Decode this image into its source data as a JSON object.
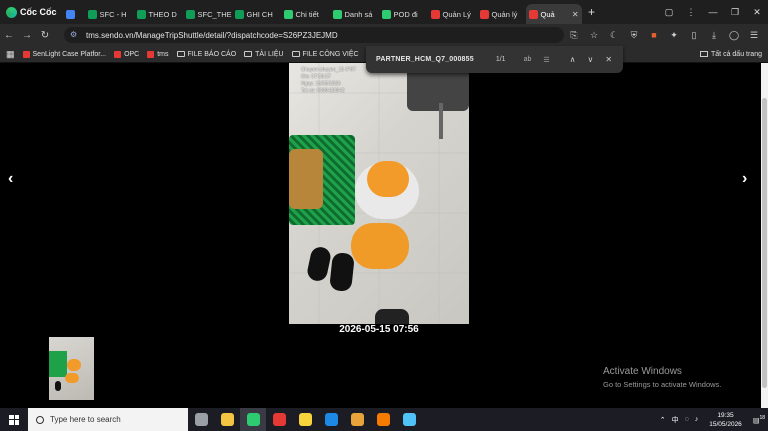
{
  "browser": {
    "brand_name": "Cốc Cốc",
    "tabs": [
      {
        "label": "",
        "icon": "drive-icon",
        "color": "#4285f4"
      },
      {
        "label": "SFC - H",
        "icon": "sheets-icon",
        "color": "#0f9d58"
      },
      {
        "label": "THEO D",
        "icon": "sheets-icon",
        "color": "#0f9d58"
      },
      {
        "label": "SFC_THE",
        "icon": "sheets-icon",
        "color": "#0f9d58"
      },
      {
        "label": "GHI CH",
        "icon": "sheets-icon",
        "color": "#0f9d58"
      },
      {
        "label": "Chi tiết",
        "icon": "globe-icon",
        "color": "#2ecc71"
      },
      {
        "label": "Danh sá",
        "icon": "globe-icon",
        "color": "#2ecc71"
      },
      {
        "label": "POD đi",
        "icon": "globe-icon",
        "color": "#2ecc71"
      },
      {
        "label": "Quản Lý",
        "icon": "sendo-icon",
        "color": "#e53935"
      },
      {
        "label": "Quản lý",
        "icon": "sendo-icon",
        "color": "#e53935"
      },
      {
        "label": "Quả",
        "icon": "sendo-icon",
        "color": "#e53935",
        "active": true
      }
    ],
    "new_tab_symbol": "+",
    "url": "tms.sendo.vn/ManageTripShuttle/detail/?dispatchcode=S26PZ3JEJMD"
  },
  "bookmarks": {
    "items": [
      {
        "label": "SenLight Case Platfor...",
        "type": "site",
        "color": "#e53935"
      },
      {
        "label": "OPC",
        "type": "site",
        "color": "#e53935"
      },
      {
        "label": "tms",
        "type": "site",
        "color": "#e53935"
      },
      {
        "label": "FILE BÁO CÁO",
        "type": "folder"
      },
      {
        "label": "TÀI LIỆU",
        "type": "folder"
      },
      {
        "label": "FILE CÔNG VIỆC",
        "type": "folder"
      }
    ],
    "all_bookmarks_label": "Tất cả dấu trang"
  },
  "find_bar": {
    "query": "PARTNER_HCM_Q7_000855",
    "match_count": "1/1"
  },
  "viewer": {
    "photo_overlay": [
      "Chuyen shuyen_15 IP6T",
      "Gio: 07:56:57",
      "Ngay: 15/05/2026",
      "Tai xe: 0969420942"
    ],
    "caption": "2026-05-15 07:56",
    "prev_symbol": "‹",
    "next_symbol": "›"
  },
  "watermark": {
    "title": "Activate Windows",
    "subtitle": "Go to Settings to activate Windows."
  },
  "taskbar": {
    "search_placeholder": "Type here to search",
    "apps": [
      {
        "name": "task-view-icon",
        "color": "#9aa0a6"
      },
      {
        "name": "file-explorer-icon",
        "color": "#f4c542"
      },
      {
        "name": "coccoc-browser-icon",
        "color": "#2ecc71",
        "active": true
      },
      {
        "name": "wps-office-icon",
        "color": "#e53935"
      },
      {
        "name": "sticky-notes-icon",
        "color": "#f7d43c"
      },
      {
        "name": "zalo-icon",
        "color": "#1e88e5"
      },
      {
        "name": "chrome-icon",
        "color": "#e8a33a"
      },
      {
        "name": "app-orange-icon",
        "color": "#f57c00"
      },
      {
        "name": "app-blue-icon",
        "color": "#4fc3f7"
      }
    ],
    "time": "19:35",
    "date": "15/05/2026",
    "notification_count": "18"
  }
}
